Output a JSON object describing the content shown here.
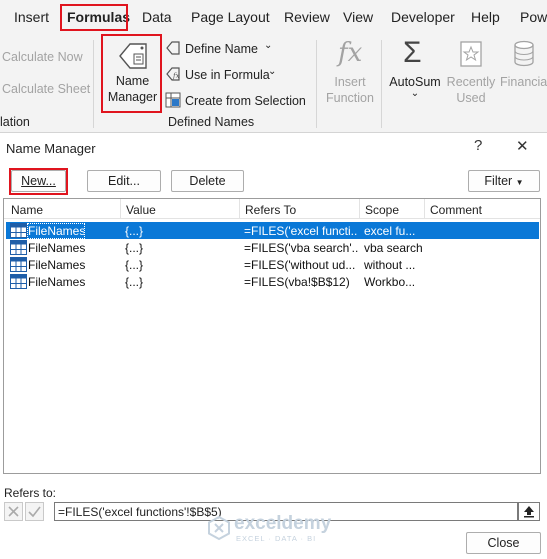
{
  "ribbon": {
    "tabs": [
      "Insert",
      "Formulas",
      "Data",
      "Page Layout",
      "Review",
      "View",
      "Developer",
      "Help",
      "Powe"
    ],
    "calc": {
      "calculate_now": "Calculate Now",
      "calculate_sheet": "Calculate Sheet",
      "group_label": "lation"
    },
    "defined_names": {
      "name_manager_line1": "Name",
      "name_manager_line2": "Manager",
      "define_name": "Define Name",
      "use_in_formula": "Use in Formula",
      "create_from_selection": "Create from Selection",
      "group_label": "Defined Names"
    },
    "function_library": {
      "insert_function_line1": "Insert",
      "insert_function_line2": "Function",
      "autosum": "AutoSum",
      "recently_used_line1": "Recently",
      "recently_used_line2": "Used",
      "financial": "Financial"
    }
  },
  "dialog": {
    "title": "Name Manager",
    "help": "?",
    "close_x": "✕",
    "buttons": {
      "new": "New...",
      "edit": "Edit...",
      "delete": "Delete",
      "filter": "Filter"
    },
    "columns": [
      "Name",
      "Value",
      "Refers To",
      "Scope",
      "Comment"
    ],
    "rows": [
      {
        "name": "FileNames",
        "value": "{...}",
        "refers_to": "=FILES('excel functi...",
        "scope": "excel fu...",
        "comment": ""
      },
      {
        "name": "FileNames",
        "value": "{...}",
        "refers_to": "=FILES('vba search'...",
        "scope": "vba search",
        "comment": ""
      },
      {
        "name": "FileNames",
        "value": "{...}",
        "refers_to": "=FILES('without ud...",
        "scope": "without ...",
        "comment": ""
      },
      {
        "name": "FileNames",
        "value": "{...}",
        "refers_to": "=FILES(vba!$B$12)",
        "scope": "Workbo...",
        "comment": ""
      }
    ],
    "refers_to_label": "Refers to:",
    "refers_to_value": "=FILES('excel functions'!$B$5)",
    "close_button": "Close"
  },
  "watermark": {
    "brand": "exceldemy",
    "tagline": "EXCEL · DATA · BI"
  },
  "colors": {
    "highlight": "#e0141e",
    "selection": "#0a78d7"
  }
}
